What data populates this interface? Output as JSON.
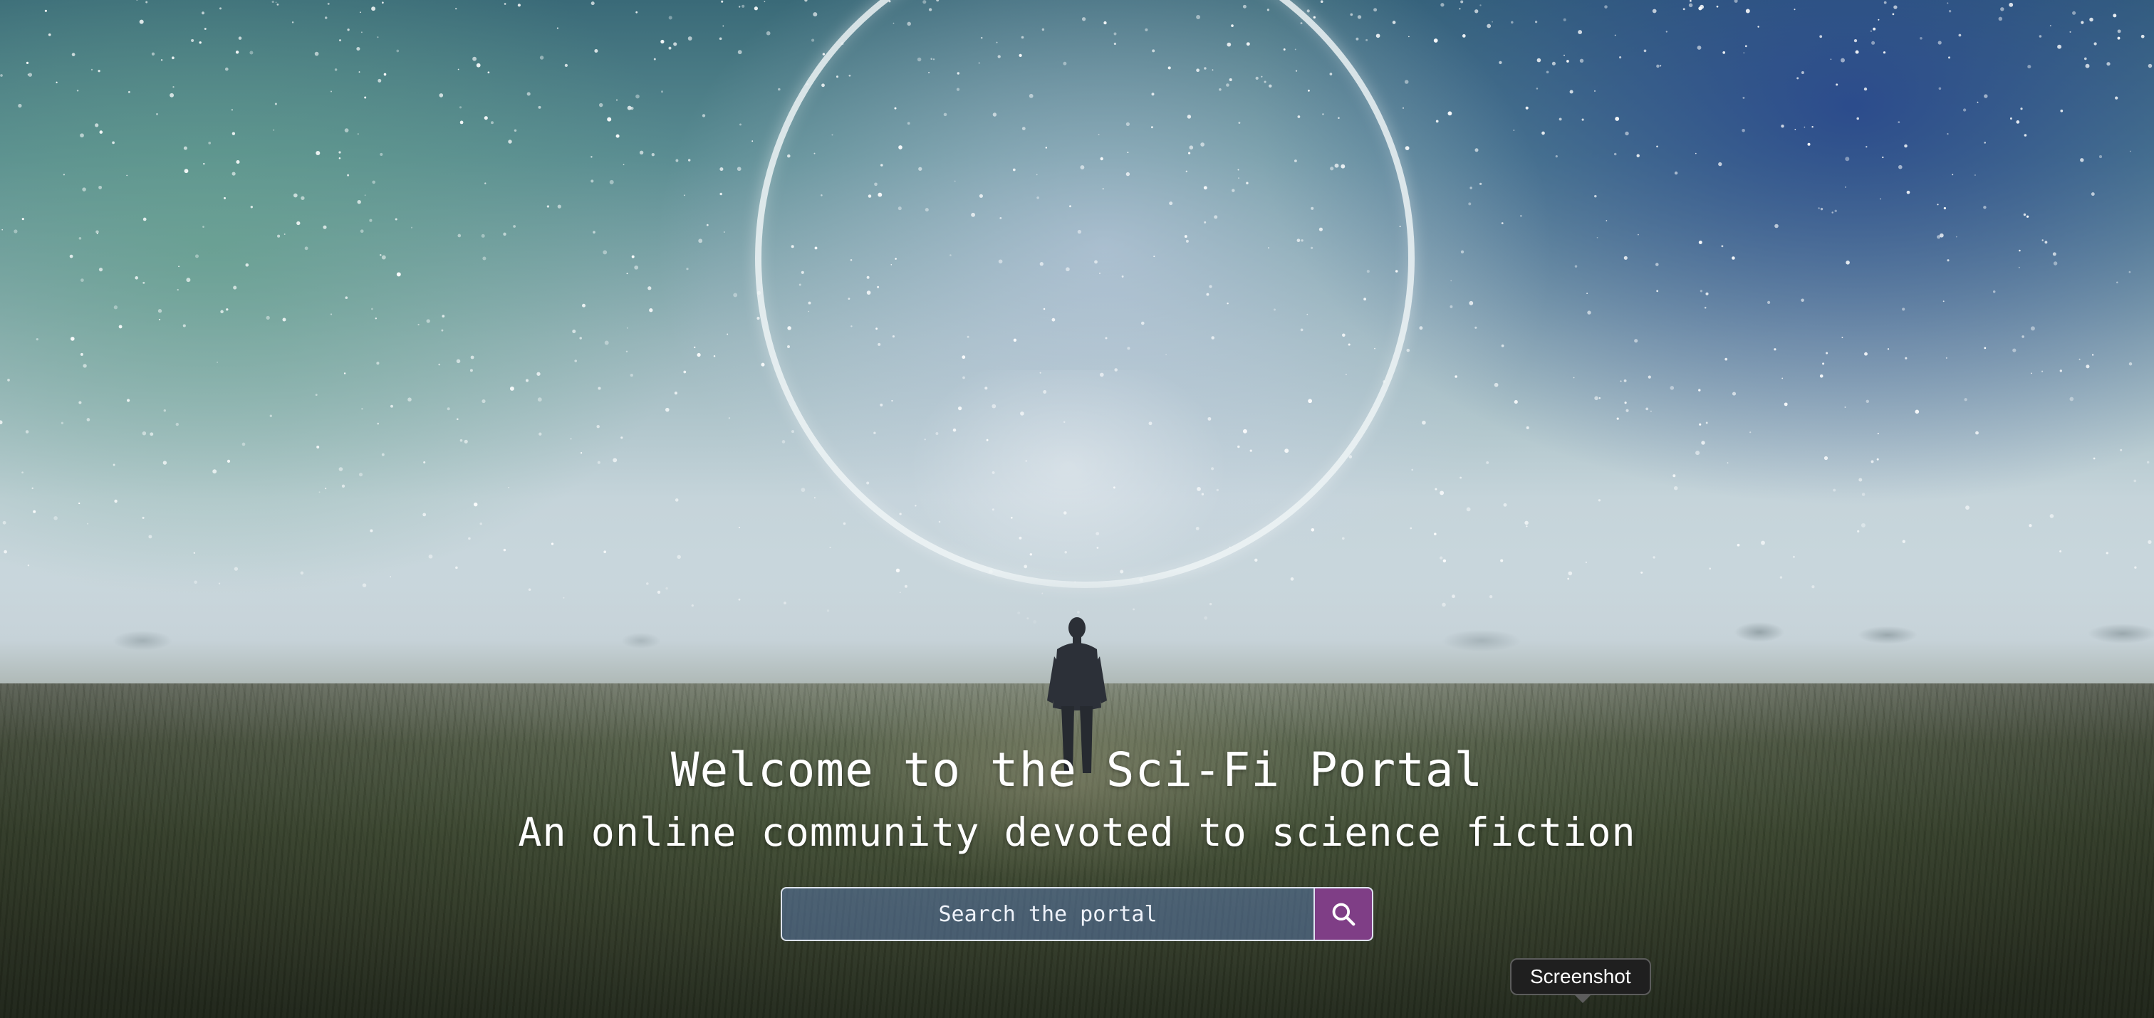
{
  "hero": {
    "background": "starry-sky-ring-field",
    "title": "Welcome to the Sci-Fi Portal",
    "subtitle": "An online community devoted to science fiction"
  },
  "search": {
    "placeholder": "Search the portal",
    "icon": "search-icon",
    "button_color": "#7f3e86"
  },
  "tooltip": {
    "label": "Screenshot"
  },
  "colors": {
    "accent": "#7f3e86",
    "text": "#ffffff"
  }
}
